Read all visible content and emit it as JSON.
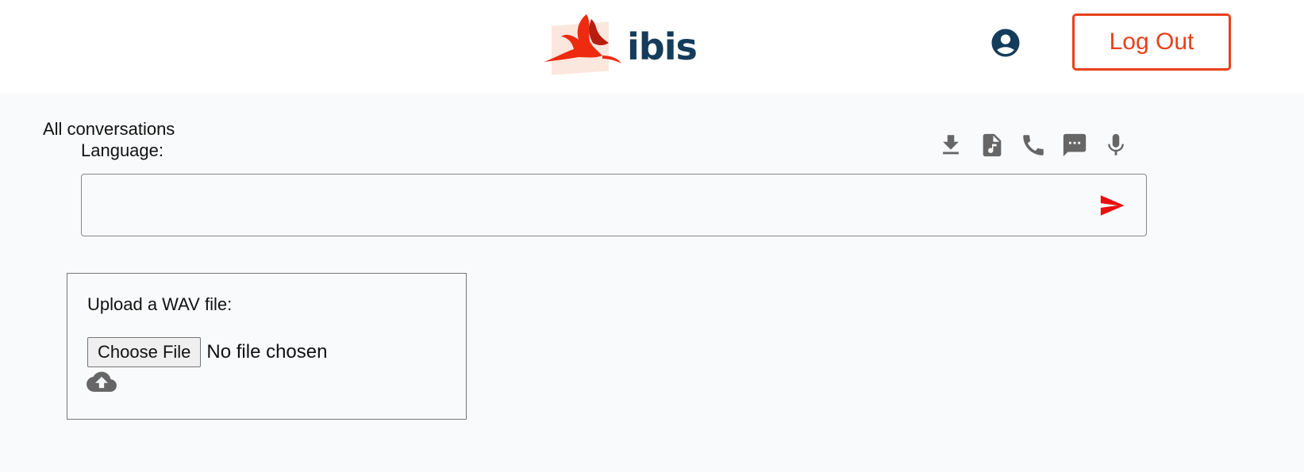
{
  "header": {
    "logo_text": "ibis",
    "logout_label": "Log Out",
    "brand_color": "#e8401a",
    "logo_text_color": "#143c5b",
    "account_icon": "account-circle-icon"
  },
  "conversation": {
    "all_conversations_label": "All conversations",
    "language_label": "Language:",
    "message_value": "",
    "toolbar_icons": [
      "download-icon",
      "audio-file-icon",
      "phone-icon",
      "chat-icon",
      "microphone-icon"
    ],
    "send_icon": "send-icon",
    "send_color": "#e81010",
    "icon_color": "#666666"
  },
  "upload": {
    "label": "Upload a WAV file:",
    "choose_file_label": "Choose File",
    "file_status": "No file chosen",
    "upload_icon": "cloud-upload-icon"
  }
}
